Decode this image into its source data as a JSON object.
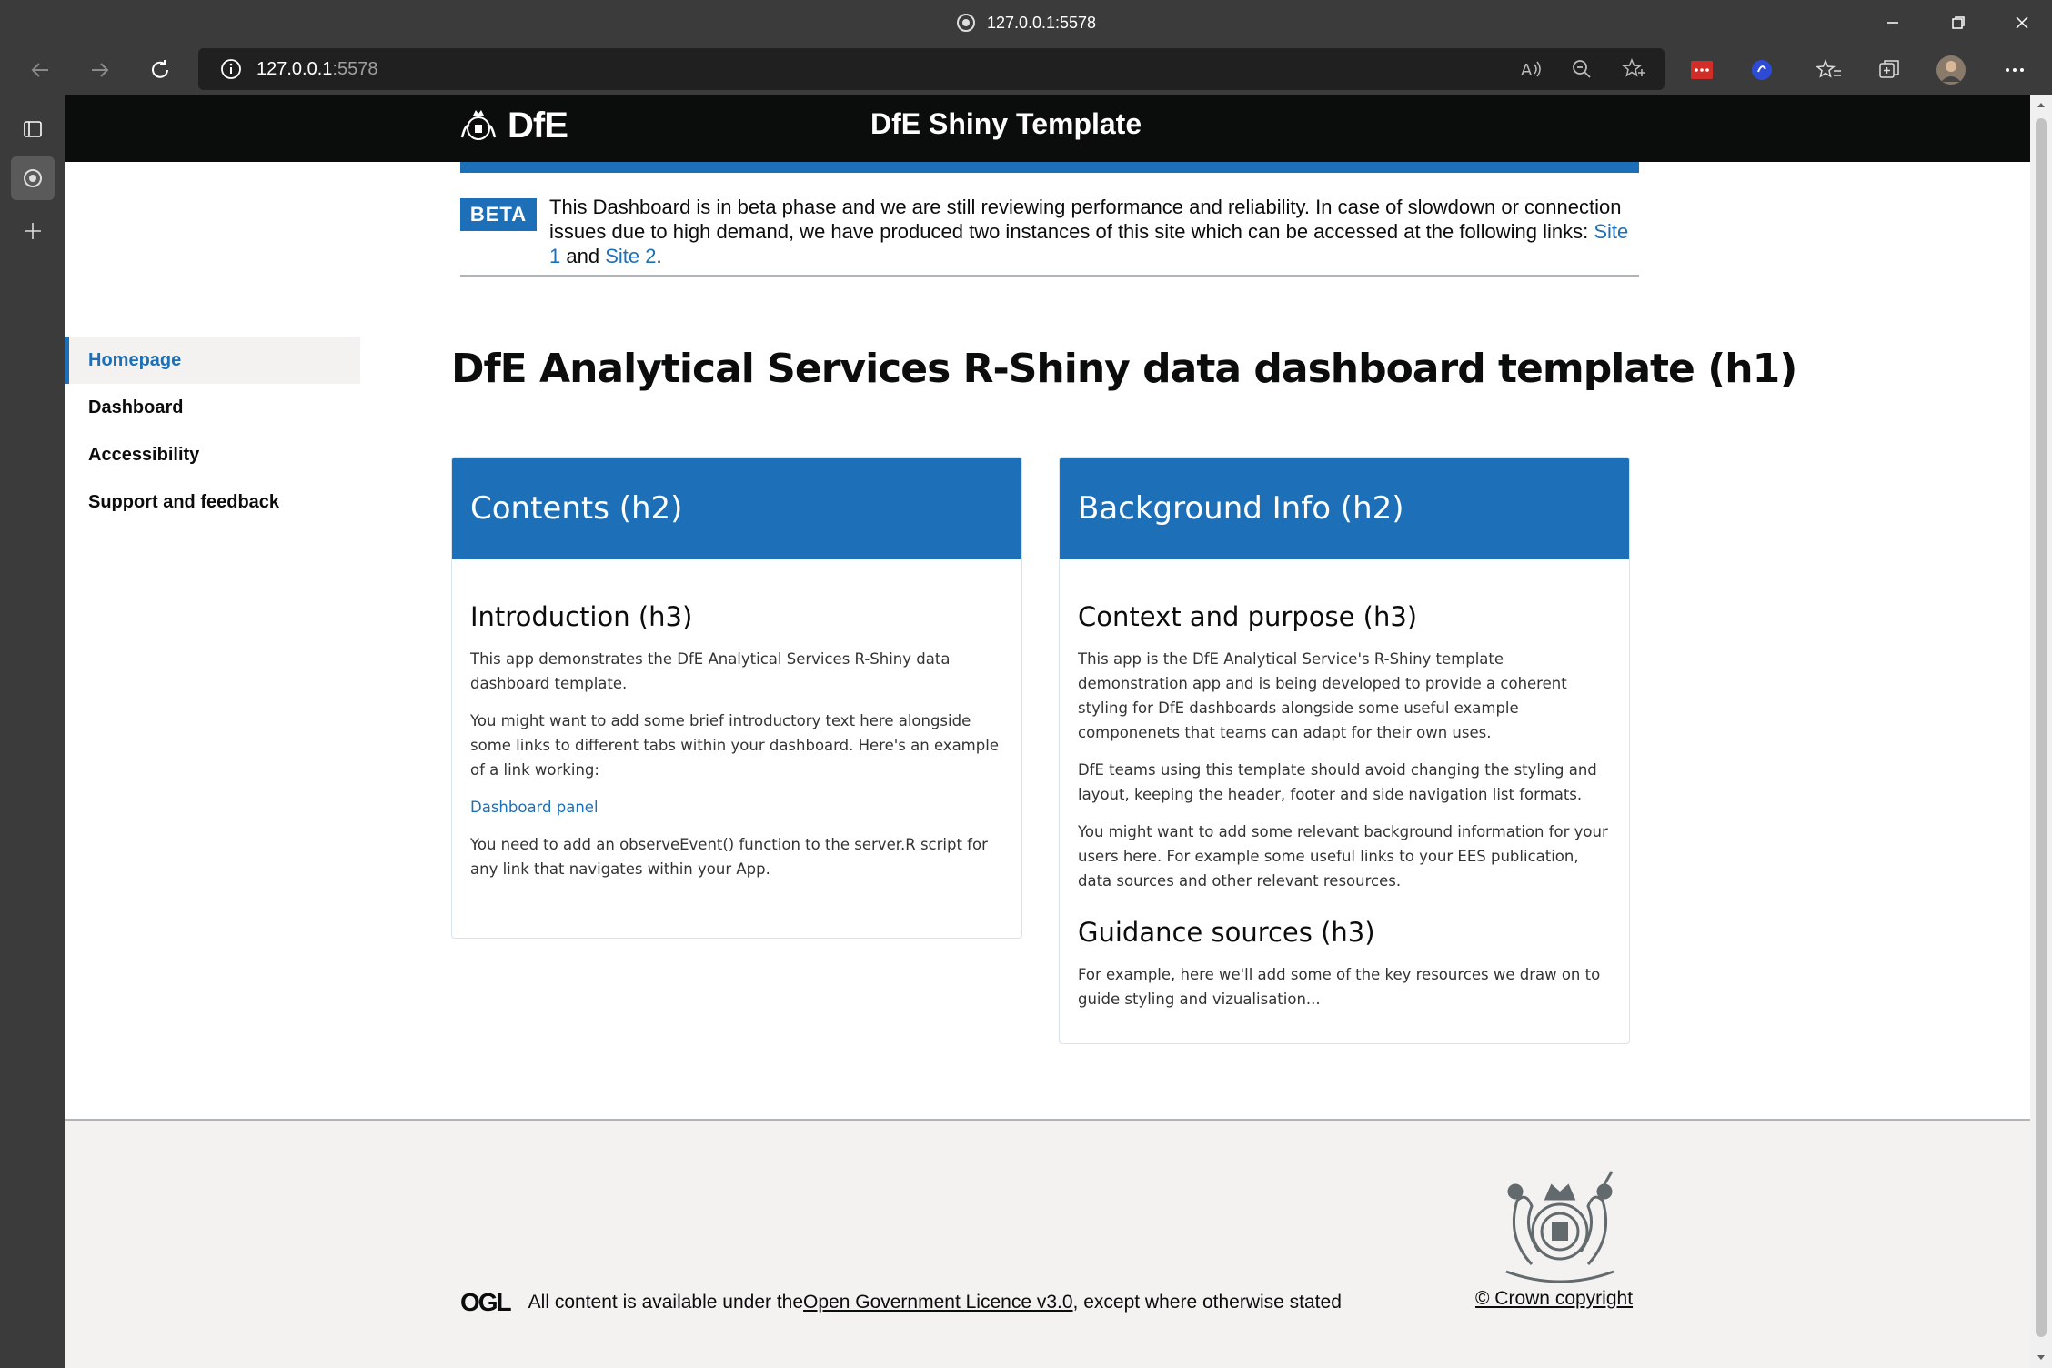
{
  "browser": {
    "window_title": "127.0.0.1:5578",
    "url_host": "127.0.0.1",
    "url_port": ":5578"
  },
  "header": {
    "logo_text": "DfE",
    "service_name": "DfE Shiny Template"
  },
  "beta_banner": {
    "tag": "BETA",
    "text_before": "This Dashboard is in beta phase and we are still reviewing performance and reliability. In case of slowdown or connection issues due to high demand, we have produced two instances of this site which can be accessed at the following links: ",
    "link1": "Site 1",
    "text_middle": " and ",
    "link2": "Site 2",
    "text_after": "."
  },
  "sidenav": {
    "items": [
      {
        "label": "Homepage",
        "active": true
      },
      {
        "label": "Dashboard",
        "active": false
      },
      {
        "label": "Accessibility",
        "active": false
      },
      {
        "label": "Support and feedback",
        "active": false
      }
    ]
  },
  "main": {
    "title": "DfE Analytical Services R-Shiny data dashboard template (h1)",
    "contents_card": {
      "heading": "Contents (h2)",
      "section_heading": "Introduction (h3)",
      "p1": "This app demonstrates the DfE Analytical Services R-Shiny data dashboard template.",
      "p2": "You might want to add some brief introductory text here alongside some links to different tabs within your dashboard. Here's an example of a link working:",
      "link": "Dashboard panel",
      "p3": "You need to add an observeEvent() function to the server.R script for any link that navigates within your App."
    },
    "background_card": {
      "heading": "Background Info (h2)",
      "section1_heading": "Context and purpose (h3)",
      "p1": "This app is the DfE Analytical Service's R-Shiny template demonstration app and is being developed to provide a coherent styling for DfE dashboards alongside some useful example componenets that teams can adapt for their own uses.",
      "p2": "DfE teams using this template should avoid changing the styling and layout, keeping the header, footer and side navigation list formats.",
      "p3": "You might want to add some relevant background information for your users here. For example some useful links to your EES publication, data sources and other relevant resources.",
      "section2_heading": "Guidance sources (h3)",
      "p4": "For example, here we'll add some of the key resources we draw on to guide styling and vizualisation..."
    }
  },
  "footer": {
    "ogl_logo": "OGL",
    "licence_before": "All content is available under the ",
    "licence_link": "Open Government Licence v3.0",
    "licence_after": " , except where otherwise stated",
    "copyright": "© Crown copyright"
  },
  "colors": {
    "brand_blue": "#1d70b8",
    "header_black": "#0b0c0c",
    "footer_grey": "#f3f2f1"
  }
}
